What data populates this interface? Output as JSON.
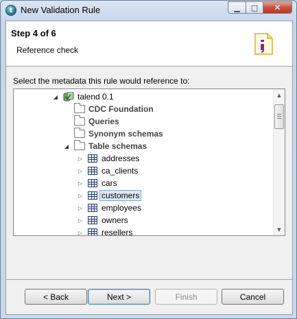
{
  "window": {
    "title": "New Validation Rule"
  },
  "banner": {
    "step": "Step 4 of 6",
    "description": "Reference check"
  },
  "prompt": "Select the metadata this rule would reference to:",
  "tree": {
    "root": "talend 0.1",
    "folders": [
      "CDC Foundation",
      "Queries",
      "Synonym schemas",
      "Table schemas"
    ],
    "tables": [
      "addresses",
      "ca_clients",
      "cars",
      "customers",
      "employees",
      "owners",
      "resellers"
    ],
    "selected": "customers"
  },
  "buttons": {
    "back": "< Back",
    "next": "Next >",
    "finish": "Finish",
    "cancel": "Cancel"
  },
  "colors": {
    "selection_border": "#7da2ce",
    "selection_fill": "#dde9f7"
  }
}
